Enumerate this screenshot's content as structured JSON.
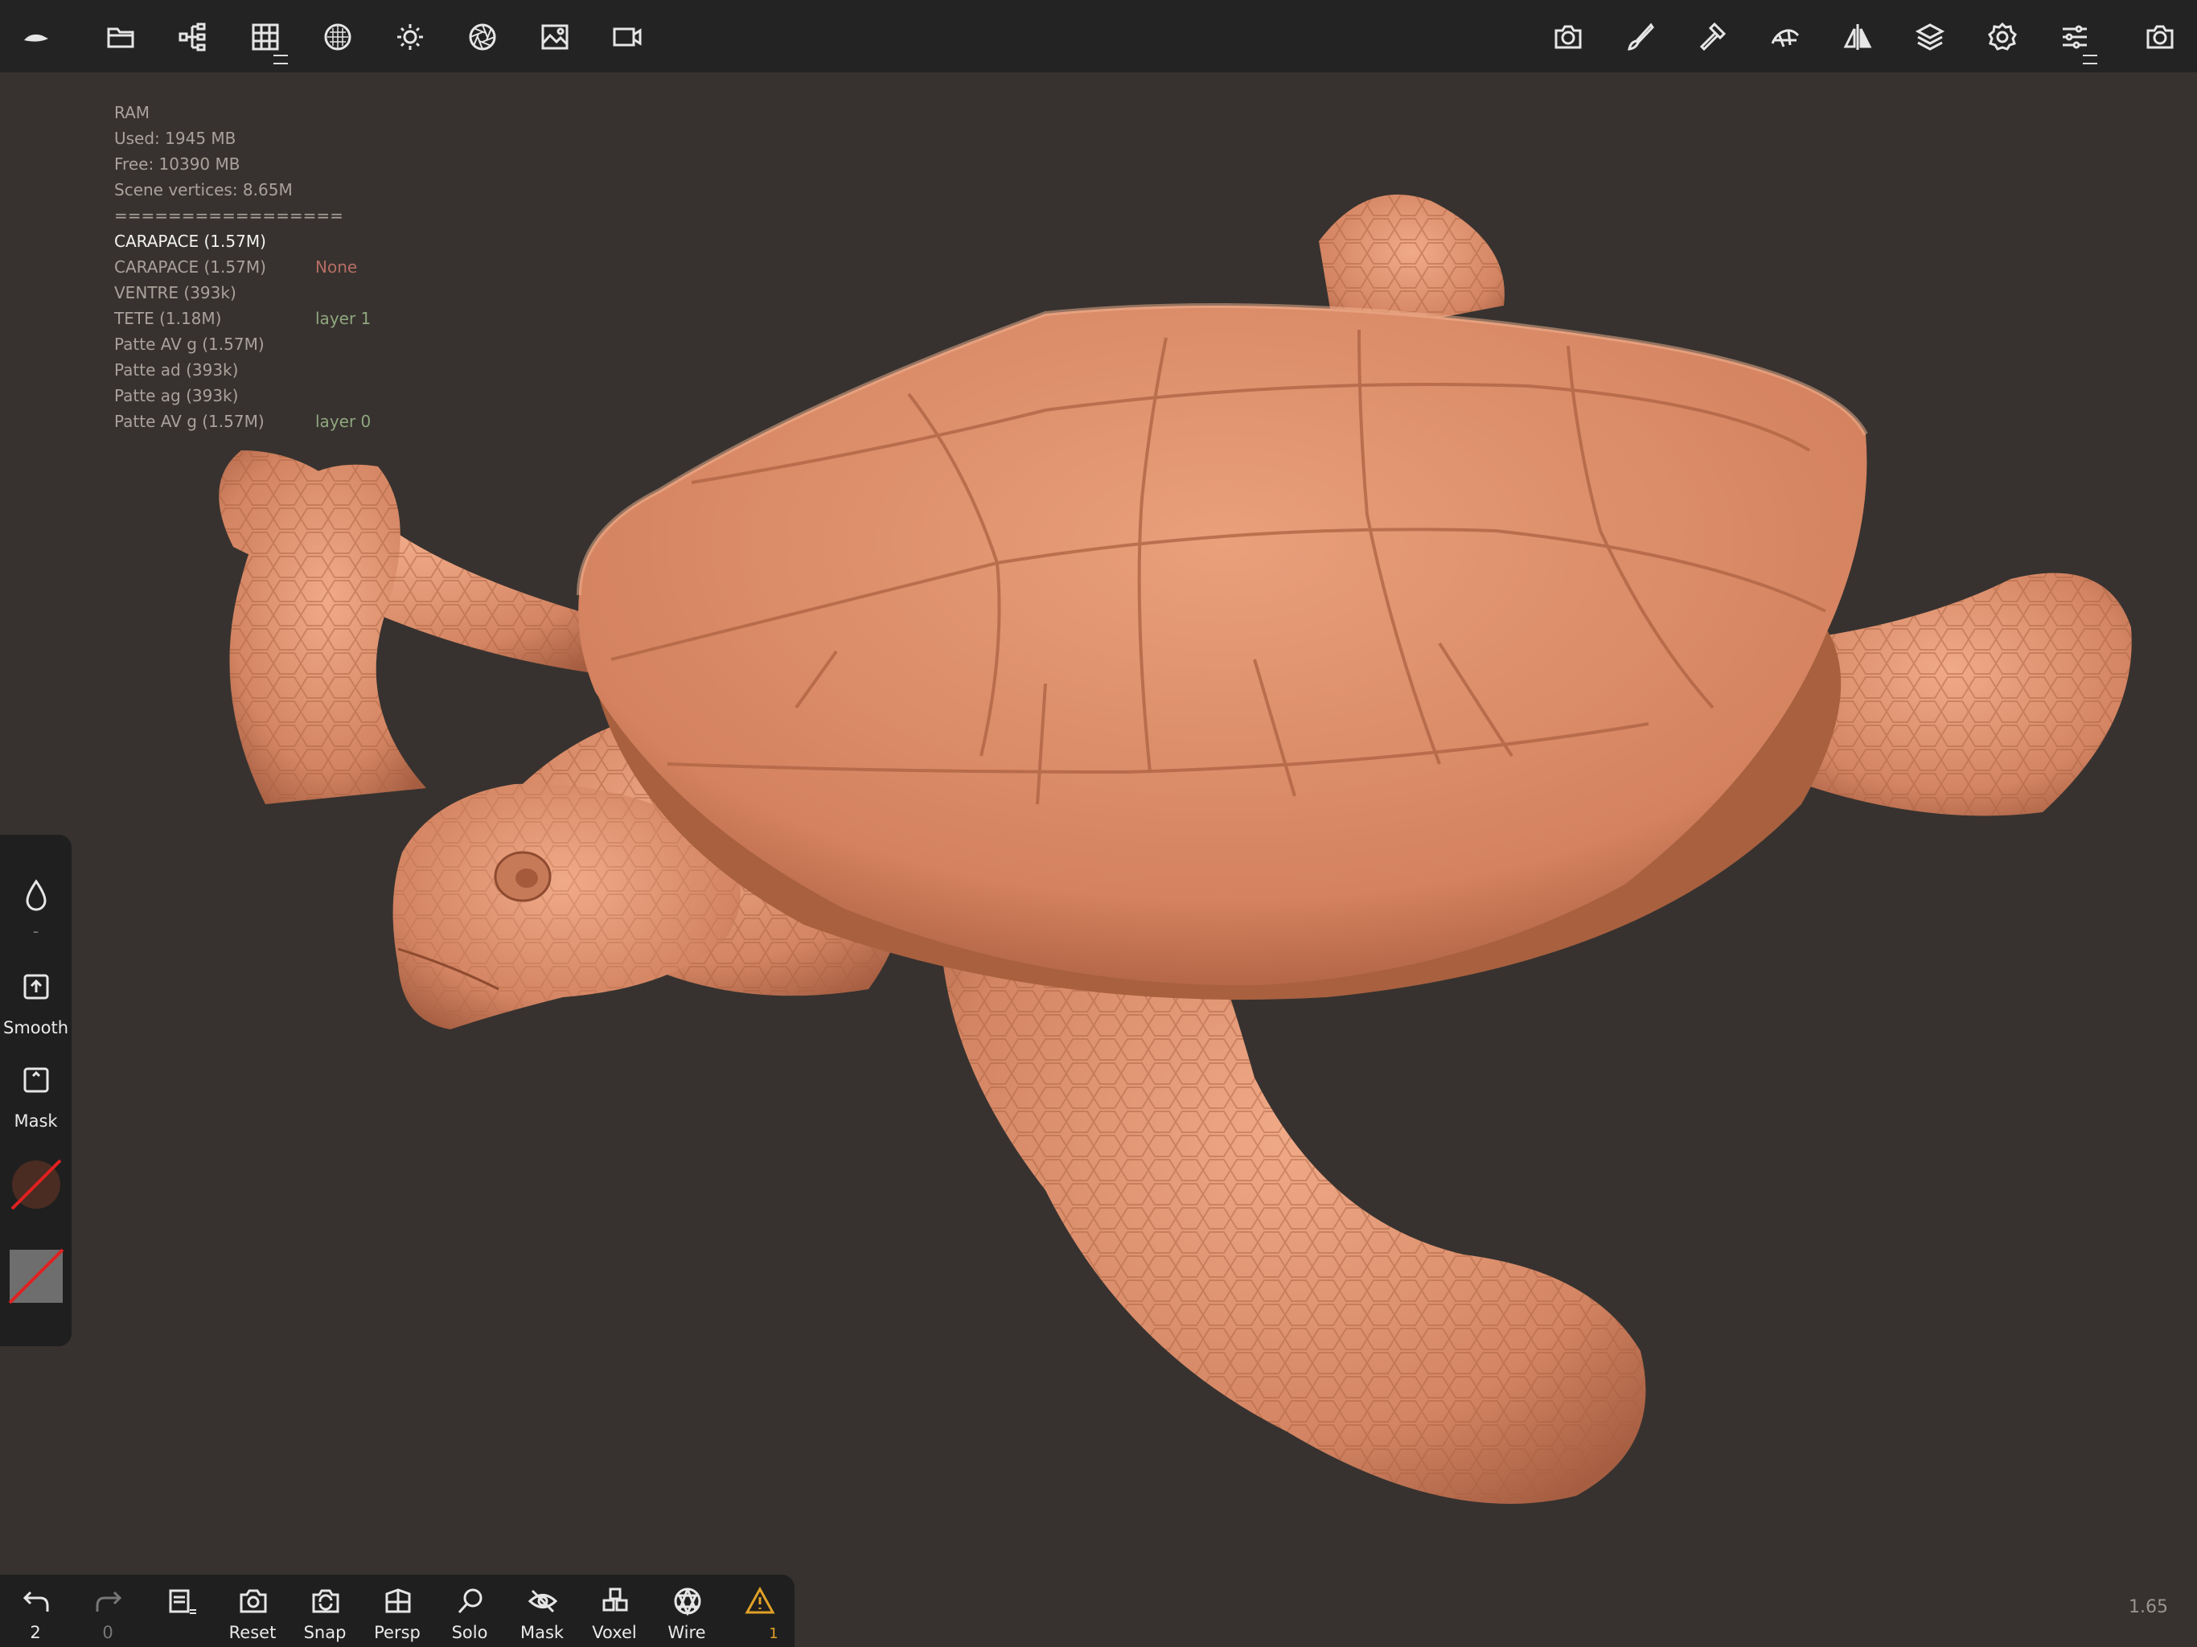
{
  "toolbar": {
    "left_icons": [
      "logo-icon",
      "folder-icon",
      "scene-tree-icon",
      "grid-icon",
      "material-sphere-icon",
      "light-sun-icon",
      "aperture-icon",
      "image-icon",
      "video-camera-icon"
    ],
    "right_icons": [
      "camera-icon",
      "brush-icon",
      "hammer-icon",
      "topology-icon",
      "symmetry-icon",
      "layers-icon",
      "settings-gear-icon",
      "sliders-icon",
      "screenshot-camera-icon"
    ]
  },
  "info": {
    "ram_title": "RAM",
    "used": "Used: 1945 MB",
    "free": "Free: 10390 MB",
    "vertices": "Scene vertices: 8.65M",
    "separator": "=================",
    "objects": [
      {
        "name": "CARAPACE (1.57M)",
        "tag": "",
        "selected": true
      },
      {
        "name": "CARAPACE (1.57M)",
        "tag": "None",
        "tag_color": "red"
      },
      {
        "name": "VENTRE (393k)",
        "tag": ""
      },
      {
        "name": "TETE (1.18M)",
        "tag": "layer 1",
        "tag_color": "green"
      },
      {
        "name": "Patte AV g (1.57M)",
        "tag": ""
      },
      {
        "name": "Patte ad (393k)",
        "tag": ""
      },
      {
        "name": "Patte ag (393k)",
        "tag": ""
      },
      {
        "name": "Patte AV g (1.57M)",
        "tag": "layer 0",
        "tag_color": "green"
      }
    ]
  },
  "side": {
    "dash": "-",
    "smooth": "Smooth",
    "mask": "Mask"
  },
  "bottom": {
    "undo_count": "2",
    "redo_count": "0",
    "reset": "Reset",
    "snap": "Snap",
    "persp": "Persp",
    "solo": "Solo",
    "mask": "Mask",
    "voxel": "Voxel",
    "wire": "Wire",
    "warning_count": "1"
  },
  "version": "1.65",
  "colors": {
    "background": "#37322f",
    "model": "#d88a68",
    "toolbar": "#232323",
    "warning": "#e0a126"
  }
}
